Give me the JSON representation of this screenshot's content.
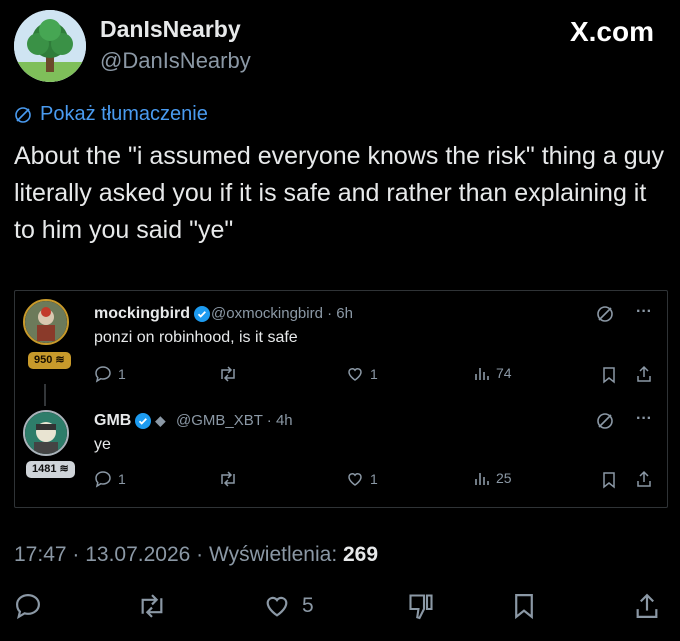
{
  "header": {
    "display_name": "DanIsNearby",
    "handle": "@DanIsNearby",
    "site": "X.com"
  },
  "translate_label": "Pokaż tłumaczenie",
  "tweet_text": "About the \"i assumed everyone knows the risk\" thing a guy literally asked you if it is safe and rather than explaining it to him you said \"ye\"",
  "quoted": [
    {
      "name": "mockingbird",
      "handle": "@oxmockingbird · 6h",
      "text": "ponzi on robinhood, is it safe",
      "badge": "950",
      "replies": "1",
      "likes": "1",
      "views": "74"
    },
    {
      "name": "GMB",
      "handle": "@GMB_XBT · 4h",
      "text": "ye",
      "badge": "1481",
      "replies": "1",
      "likes": "1",
      "views": "25"
    }
  ],
  "meta": {
    "time_date": "17:47 · 13.07.2026 · Wyświetlenia: ",
    "views": "269"
  },
  "bottom_bar": {
    "likes": "5"
  },
  "icons": [
    "reply-icon",
    "retweet-icon",
    "like-icon",
    "views-icon",
    "bookmark-icon",
    "share-icon",
    "translate-icon",
    "more-icon",
    "verified-icon",
    "dislike-icon"
  ],
  "colors": {
    "accent": "#4a9bf0",
    "verified": "#1d9bf0",
    "gold_badge": "#c89a2b"
  }
}
